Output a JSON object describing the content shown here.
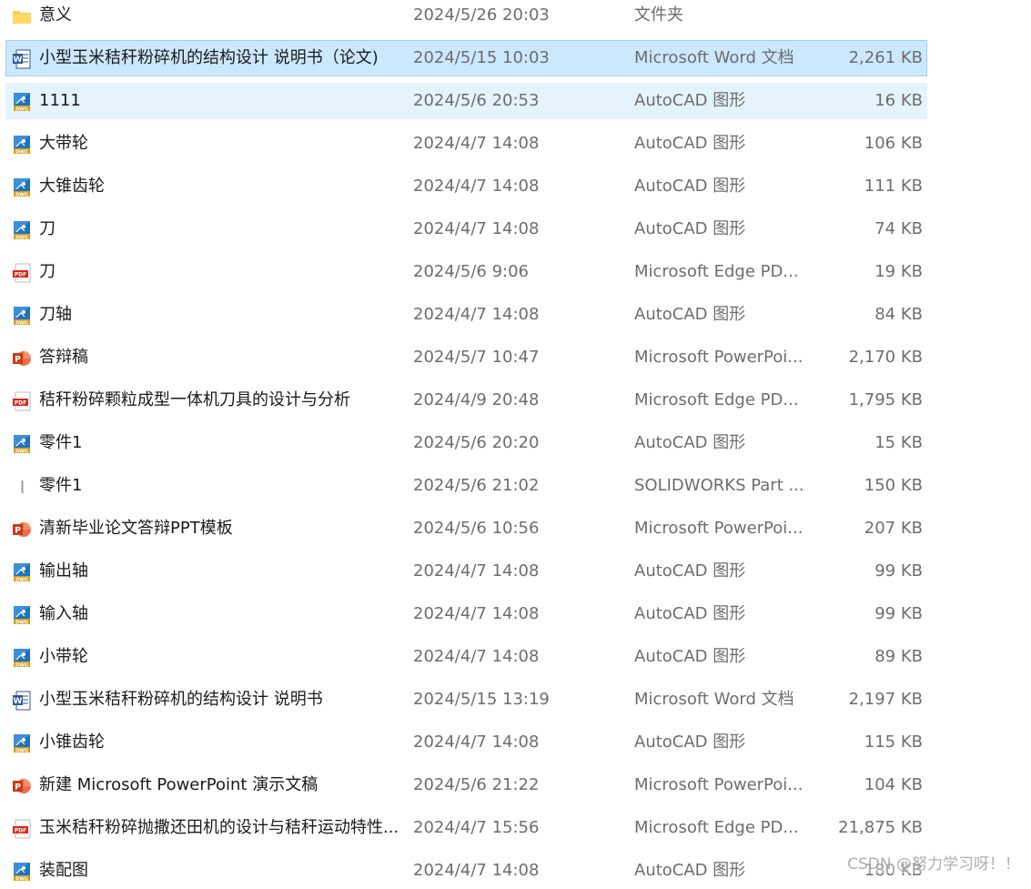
{
  "files": [
    {
      "name": "意义",
      "date": "2024/5/26 20:03",
      "type": "文件夹",
      "size": "",
      "icon": "folder-icon",
      "state": ""
    },
    {
      "name": "小型玉米秸秆粉碎机的结构设计 说明书（论文)",
      "date": "2024/5/15 10:03",
      "type": "Microsoft Word 文档",
      "size": "2,261 KB",
      "icon": "word-icon",
      "state": "selected"
    },
    {
      "name": "1111",
      "date": "2024/5/6 20:53",
      "type": "AutoCAD 图形",
      "size": "16 KB",
      "icon": "dwg-icon",
      "state": "hover"
    },
    {
      "name": "大带轮",
      "date": "2024/4/7 14:08",
      "type": "AutoCAD 图形",
      "size": "106 KB",
      "icon": "dwg-icon",
      "state": ""
    },
    {
      "name": "大锥齿轮",
      "date": "2024/4/7 14:08",
      "type": "AutoCAD 图形",
      "size": "111 KB",
      "icon": "dwg-icon",
      "state": ""
    },
    {
      "name": "刀",
      "date": "2024/4/7 14:08",
      "type": "AutoCAD 图形",
      "size": "74 KB",
      "icon": "dwg-icon",
      "state": ""
    },
    {
      "name": "刀",
      "date": "2024/5/6 9:06",
      "type": "Microsoft Edge PD...",
      "size": "19 KB",
      "icon": "pdf-icon",
      "state": ""
    },
    {
      "name": "刀轴",
      "date": "2024/4/7 14:08",
      "type": "AutoCAD 图形",
      "size": "84 KB",
      "icon": "dwg-icon",
      "state": ""
    },
    {
      "name": "答辩稿",
      "date": "2024/5/7 10:47",
      "type": "Microsoft PowerPoi...",
      "size": "2,170 KB",
      "icon": "powerpoint-icon",
      "state": ""
    },
    {
      "name": "秸秆粉碎颗粒成型一体机刀具的设计与分析",
      "date": "2024/4/9 20:48",
      "type": "Microsoft Edge PD...",
      "size": "1,795 KB",
      "icon": "pdf-icon",
      "state": ""
    },
    {
      "name": "零件1",
      "date": "2024/5/6 20:20",
      "type": "AutoCAD 图形",
      "size": "15 KB",
      "icon": "dwg-icon",
      "state": ""
    },
    {
      "name": "零件1",
      "date": "2024/5/6 21:02",
      "type": "SOLIDWORKS Part ...",
      "size": "150 KB",
      "icon": "solidworks-part-icon",
      "state": ""
    },
    {
      "name": "清新毕业论文答辩PPT模板",
      "date": "2024/5/6 10:56",
      "type": "Microsoft PowerPoi...",
      "size": "207 KB",
      "icon": "powerpoint-icon",
      "state": ""
    },
    {
      "name": "输出轴",
      "date": "2024/4/7 14:08",
      "type": "AutoCAD 图形",
      "size": "99 KB",
      "icon": "dwg-icon",
      "state": ""
    },
    {
      "name": "输入轴",
      "date": "2024/4/7 14:08",
      "type": "AutoCAD 图形",
      "size": "99 KB",
      "icon": "dwg-icon",
      "state": ""
    },
    {
      "name": "小带轮",
      "date": "2024/4/7 14:08",
      "type": "AutoCAD 图形",
      "size": "89 KB",
      "icon": "dwg-icon",
      "state": ""
    },
    {
      "name": "小型玉米秸秆粉碎机的结构设计 说明书",
      "date": "2024/5/15 13:19",
      "type": "Microsoft Word 文档",
      "size": "2,197 KB",
      "icon": "word-icon",
      "state": ""
    },
    {
      "name": "小锥齿轮",
      "date": "2024/4/7 14:08",
      "type": "AutoCAD 图形",
      "size": "115 KB",
      "icon": "dwg-icon",
      "state": ""
    },
    {
      "name": "新建 Microsoft PowerPoint 演示文稿",
      "date": "2024/5/6 21:22",
      "type": "Microsoft PowerPoi...",
      "size": "104 KB",
      "icon": "powerpoint-icon",
      "state": ""
    },
    {
      "name": "玉米秸秆粉碎抛撒还田机的设计与秸秆运动特性...",
      "date": "2024/4/7 15:56",
      "type": "Microsoft Edge PD...",
      "size": "21,875 KB",
      "icon": "pdf-icon",
      "state": ""
    },
    {
      "name": "装配图",
      "date": "2024/4/7 14:08",
      "type": "AutoCAD 图形",
      "size": "180 KB",
      "icon": "dwg-icon",
      "state": ""
    }
  ],
  "watermark": "CSDN @努力学习呀！！",
  "colors": {
    "selected_bg": "#cce8ff",
    "selected_border": "#99d1ff",
    "hover_bg": "#e5f3ff",
    "name_text": "#1a1a1a",
    "meta_text": "#6d6d6d"
  }
}
